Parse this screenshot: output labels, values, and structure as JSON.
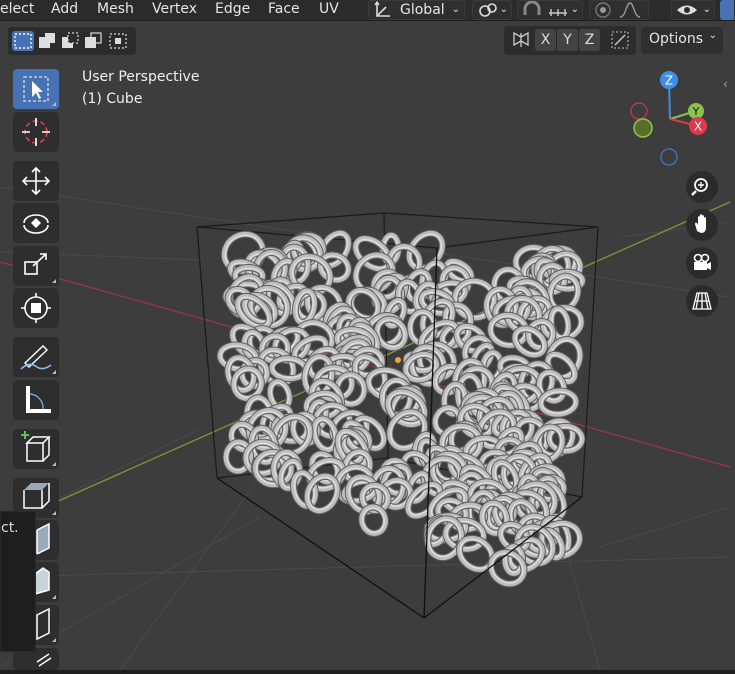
{
  "menu": [
    "elect",
    "Add",
    "Mesh",
    "Vertex",
    "Edge",
    "Face",
    "UV"
  ],
  "transform_orientation": "Global",
  "axis_buttons": [
    "X",
    "Y",
    "Z"
  ],
  "options_label": "Options",
  "viewport": {
    "view_name": "User Perspective",
    "object_name": "(1) Cube"
  },
  "gizmo": {
    "x": "X",
    "y": "Y",
    "z": "Z"
  },
  "tooltip_text": "ct.",
  "colors": {
    "accent": "#4772b3",
    "x_axis": "#e0394d",
    "y_axis": "#8bc34a",
    "z_axis": "#3d8ee6",
    "origin": "#f5a623"
  }
}
